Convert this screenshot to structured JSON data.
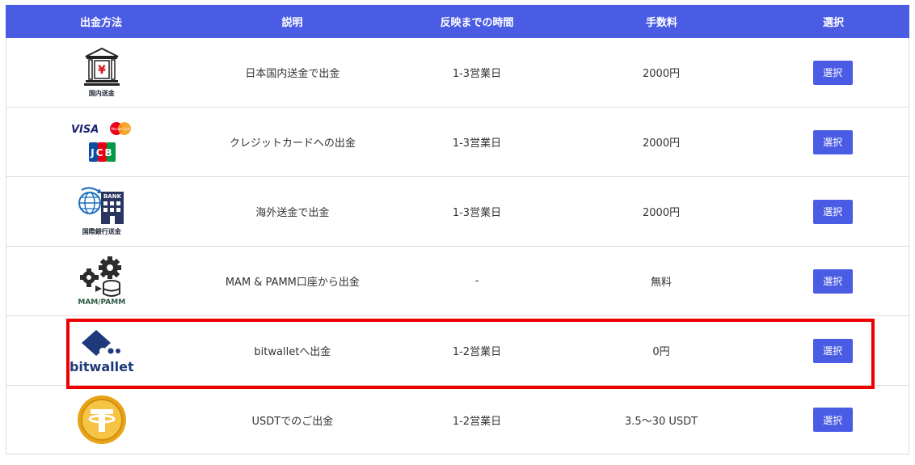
{
  "header": {
    "method": "出金方法",
    "description": "説明",
    "time": "反映までの時間",
    "fee": "手数料",
    "select": "選択"
  },
  "rows": [
    {
      "logo_caption": "国内送金",
      "icon": "domestic-bank-icon",
      "description": "日本国内送金で出金",
      "time": "1-3営業日",
      "fee": "2000円",
      "button": "選択"
    },
    {
      "logo_caption": "",
      "icon": "credit-card-brands-icon",
      "logo_text": {
        "visa": "VISA",
        "mastercard": "MasterCard",
        "jcb": "JCB"
      },
      "description": "クレジットカードへの出金",
      "time": "1-3営業日",
      "fee": "2000円",
      "button": "選択"
    },
    {
      "logo_caption": "国際銀行送金",
      "icon": "international-bank-icon",
      "logo_text": {
        "bank": "BANK"
      },
      "description": "海外送金で出金",
      "time": "1-3営業日",
      "fee": "2000円",
      "button": "選択"
    },
    {
      "logo_caption": "MAM/PAMM",
      "icon": "mam-pamm-gears-icon",
      "description": "MAM & PAMM口座から出金",
      "time": "-",
      "fee": "無料",
      "button": "選択"
    },
    {
      "logo_caption": "bitwallet",
      "icon": "bitwallet-logo-icon",
      "description": "bitwalletへ出金",
      "time": "1-2営業日",
      "fee": "0円",
      "button": "選択"
    },
    {
      "logo_caption": "",
      "icon": "usdt-tether-coin-icon",
      "description": "USDTでのご出金",
      "time": "1-2営業日",
      "fee": "3.5～30 USDT",
      "button": "選択"
    }
  ],
  "colors": {
    "header_bg": "#4a5ce4",
    "button_bg": "#4a5ce4",
    "highlight": "#ee0000",
    "bitwallet": "#1e3a7b",
    "usdt": "#e8a317"
  }
}
